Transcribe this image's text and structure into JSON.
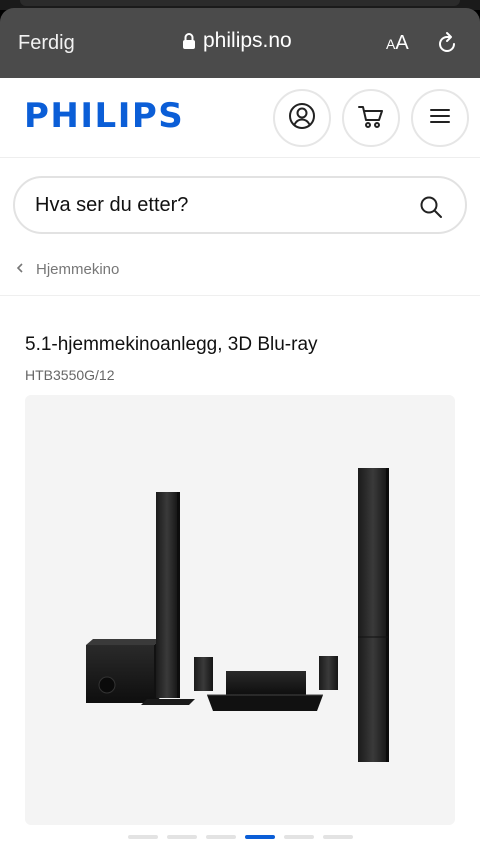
{
  "browser": {
    "done_label": "Ferdig",
    "url": "philips.no",
    "text_size_small": "A",
    "text_size_big": "A"
  },
  "header": {
    "logo": "PHILIPS",
    "accent_color": "#0b5ed7"
  },
  "icons": {
    "account": "account-icon",
    "cart": "cart-icon",
    "menu": "hamburger-menu-icon",
    "search": "search-icon",
    "reload": "reload-icon",
    "lock": "lock-icon",
    "back": "chevron-left-icon"
  },
  "search": {
    "placeholder": "Hva ser du etter?"
  },
  "breadcrumb": {
    "label": "Hjemmekino"
  },
  "product": {
    "title": "5.1-hjemmekinoanlegg, 3D Blu-ray",
    "sku": "HTB3550G/12"
  },
  "gallery": {
    "slide_count": 6,
    "active_index": 3
  }
}
